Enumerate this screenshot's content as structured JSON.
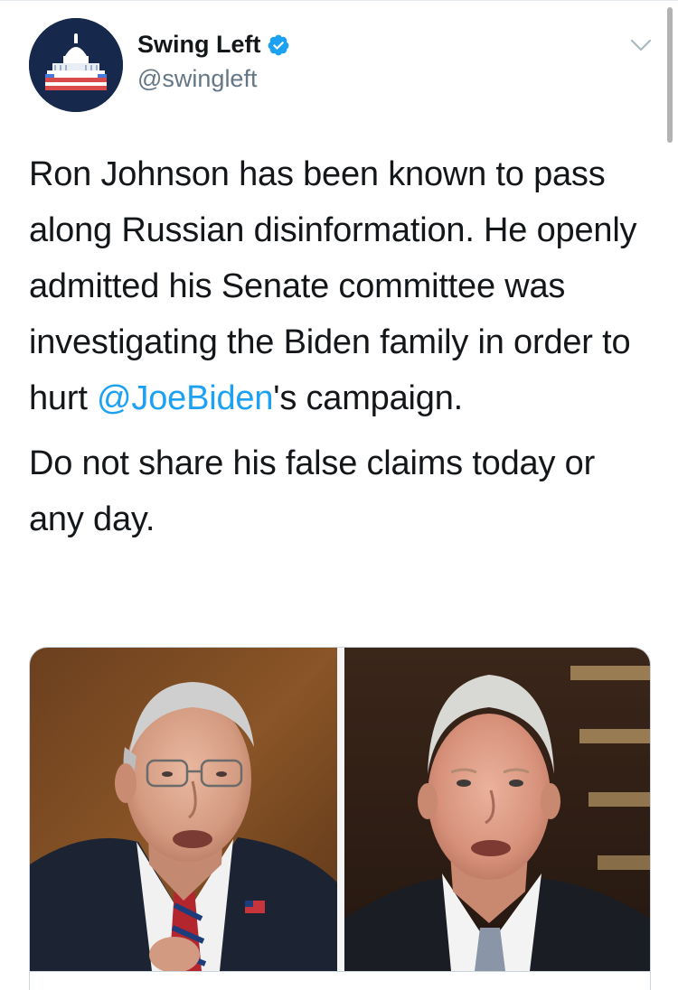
{
  "tweet": {
    "display_name": "Swing Left",
    "handle": "@swingleft",
    "verified": true,
    "paragraph1_before": "Ron Johnson has been known to pass along Russian disinformation. He openly admitted his Senate committee was investigating the Biden family in order to hurt ",
    "mention": "@JoeBiden",
    "paragraph1_after": "'s campaign.",
    "paragraph2": "Do not share his false claims today or any day."
  },
  "icons": {
    "avatar": "capitol-dome-avatar",
    "verified": "verified-badge-icon",
    "menu": "chevron-down-icon"
  },
  "colors": {
    "link": "#1da1f2",
    "text": "#14171a",
    "secondary": "#657786",
    "avatar_bg": "#16294d"
  }
}
